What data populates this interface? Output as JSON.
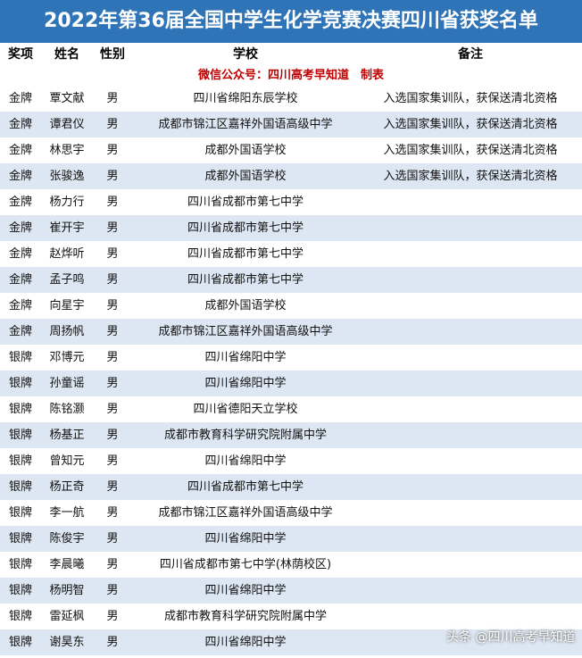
{
  "title": "2022年第36届全国中学生化学竞赛决赛四川省获奖名单",
  "headers": {
    "award": "奖项",
    "name": "姓名",
    "gender": "性别",
    "school": "学校",
    "note": "备注"
  },
  "producer_note": "微信公众号：四川高考早知道　制表",
  "rows": [
    {
      "award": "金牌",
      "name": "覃文献",
      "gender": "男",
      "school": "四川省绵阳东辰学校",
      "note": "入选国家集训队，获保送清北资格"
    },
    {
      "award": "金牌",
      "name": "谭君仪",
      "gender": "男",
      "school": "成都市锦江区嘉祥外国语高级中学",
      "note": "入选国家集训队，获保送清北资格"
    },
    {
      "award": "金牌",
      "name": "林思宇",
      "gender": "男",
      "school": "成都外国语学校",
      "note": "入选国家集训队，获保送清北资格"
    },
    {
      "award": "金牌",
      "name": "张骏逸",
      "gender": "男",
      "school": "成都外国语学校",
      "note": "入选国家集训队，获保送清北资格"
    },
    {
      "award": "金牌",
      "name": "杨力行",
      "gender": "男",
      "school": "四川省成都市第七中学",
      "note": ""
    },
    {
      "award": "金牌",
      "name": "崔开宇",
      "gender": "男",
      "school": "四川省成都市第七中学",
      "note": ""
    },
    {
      "award": "金牌",
      "name": "赵烨听",
      "gender": "男",
      "school": "四川省成都市第七中学",
      "note": ""
    },
    {
      "award": "金牌",
      "name": "孟子鸣",
      "gender": "男",
      "school": "四川省成都市第七中学",
      "note": ""
    },
    {
      "award": "金牌",
      "name": "向星宇",
      "gender": "男",
      "school": "成都外国语学校",
      "note": ""
    },
    {
      "award": "金牌",
      "name": "周扬帆",
      "gender": "男",
      "school": "成都市锦江区嘉祥外国语高级中学",
      "note": ""
    },
    {
      "award": "银牌",
      "name": "邓博元",
      "gender": "男",
      "school": "四川省绵阳中学",
      "note": ""
    },
    {
      "award": "银牌",
      "name": "孙童谣",
      "gender": "男",
      "school": "四川省绵阳中学",
      "note": ""
    },
    {
      "award": "银牌",
      "name": "陈铭灏",
      "gender": "男",
      "school": "四川省德阳天立学校",
      "note": ""
    },
    {
      "award": "银牌",
      "name": "杨基正",
      "gender": "男",
      "school": "成都市教育科学研究院附属中学",
      "note": ""
    },
    {
      "award": "银牌",
      "name": "曾知元",
      "gender": "男",
      "school": "四川省绵阳中学",
      "note": ""
    },
    {
      "award": "银牌",
      "name": "杨正奇",
      "gender": "男",
      "school": "四川省成都市第七中学",
      "note": ""
    },
    {
      "award": "银牌",
      "name": "李一航",
      "gender": "男",
      "school": "成都市锦江区嘉祥外国语高级中学",
      "note": ""
    },
    {
      "award": "银牌",
      "name": "陈俊宇",
      "gender": "男",
      "school": "四川省绵阳中学",
      "note": ""
    },
    {
      "award": "银牌",
      "name": "李晨曦",
      "gender": "男",
      "school": "四川省成都市第七中学(林荫校区)",
      "note": ""
    },
    {
      "award": "银牌",
      "name": "杨明智",
      "gender": "男",
      "school": "四川省绵阳中学",
      "note": ""
    },
    {
      "award": "银牌",
      "name": "雷延枫",
      "gender": "男",
      "school": "成都市教育科学研究院附属中学",
      "note": ""
    },
    {
      "award": "银牌",
      "name": "谢昊东",
      "gender": "男",
      "school": "四川省绵阳中学",
      "note": ""
    }
  ],
  "watermark": "头条 @四川高考早知道",
  "colors": {
    "title_bg": "#2f74b6",
    "stripe": "#dde7f3",
    "note_red": "#c00000"
  }
}
